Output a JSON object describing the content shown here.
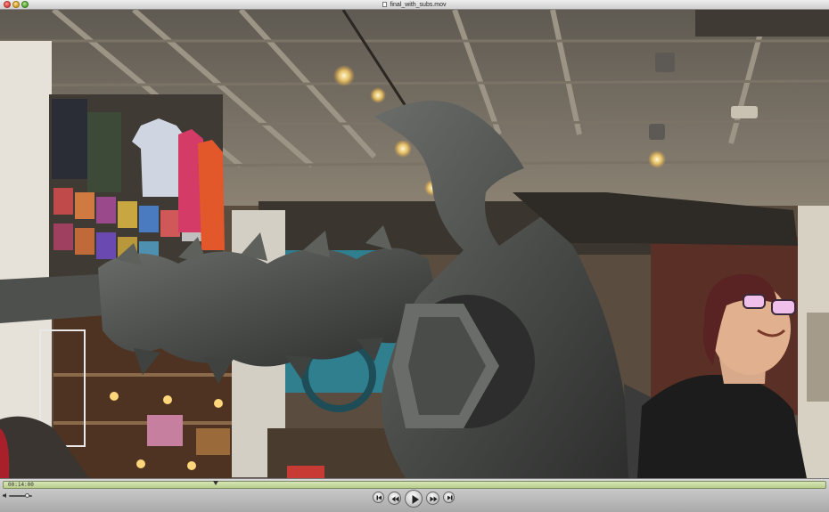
{
  "window": {
    "title": "final_with_subs.mov"
  },
  "player": {
    "timecode": "00:14:00",
    "playhead_fraction": 0.255,
    "volume_fraction": 0.85
  },
  "icons": {
    "close": "close-icon",
    "minimize": "minimize-icon",
    "zoom": "zoom-icon",
    "document": "document-icon",
    "volume": "speaker-icon",
    "skip_back": "skip-to-start-icon",
    "rewind": "rewind-icon",
    "play": "play-icon",
    "fast_forward": "fast-forward-icon",
    "skip_forward": "skip-to-end-icon"
  },
  "colors": {
    "scrubber_fill": "#c8dba0",
    "controls_bg": "#bfbfbf"
  }
}
